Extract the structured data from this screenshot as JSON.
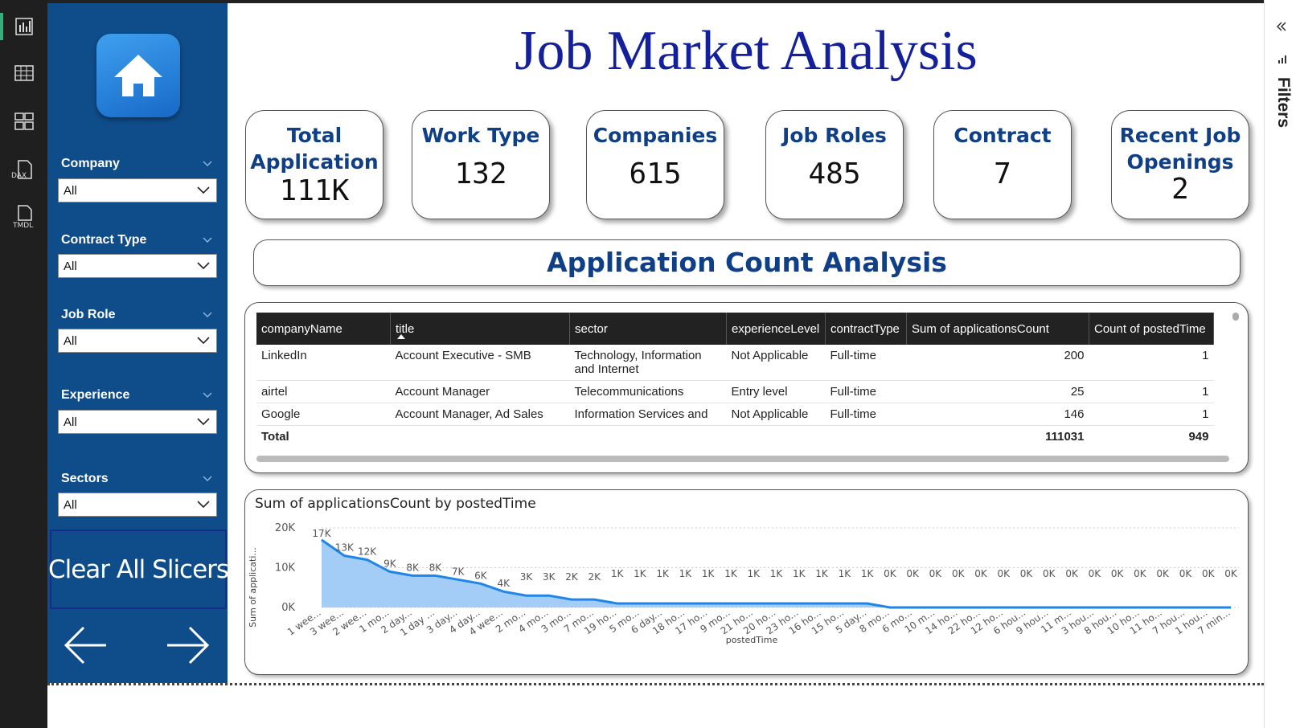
{
  "page_title": "Job Market Analysis",
  "slicers": [
    {
      "label": "Company",
      "value": "All"
    },
    {
      "label": "Contract Type",
      "value": "All"
    },
    {
      "label": "Job Role",
      "value": "All"
    },
    {
      "label": "Experience",
      "value": "All"
    },
    {
      "label": "Sectors",
      "value": "All"
    }
  ],
  "clear_button": "Clear All Slicers",
  "rail_icons": [
    "report-view-icon",
    "table-view-icon",
    "model-view-icon",
    "dax-query-icon",
    "tmdl-view-icon"
  ],
  "rail_labels": {
    "dax": "DAX",
    "tmdl": "TMDL"
  },
  "cards": [
    {
      "title": "Total Application",
      "value": "111K"
    },
    {
      "title": "Work Type",
      "value": "132"
    },
    {
      "title": "Companies",
      "value": "615"
    },
    {
      "title": "Job Roles",
      "value": "485"
    },
    {
      "title": "Contract",
      "value": "7"
    },
    {
      "title": "Recent Job Openings",
      "value": "2"
    }
  ],
  "section_banner": "Application Count Analysis",
  "table": {
    "columns": [
      "companyName",
      "title",
      "sector",
      "experienceLevel",
      "contractType",
      "Sum of applicationsCount",
      "Count of postedTime"
    ],
    "rows": [
      [
        "LinkedIn",
        "Account Executive - SMB",
        "Technology, Information and Internet",
        "Not Applicable",
        "Full-time",
        "200",
        "1"
      ],
      [
        "airtel",
        "Account Manager",
        "Telecommunications",
        "Entry level",
        "Full-time",
        "25",
        "1"
      ],
      [
        "Google",
        "Account Manager, Ad Sales",
        "Information Services and",
        "Not Applicable",
        "Full-time",
        "146",
        "1"
      ]
    ],
    "total": {
      "label": "Total",
      "sum": "111031",
      "count": "949"
    }
  },
  "filters_pane": {
    "label": "Filters"
  },
  "chart_data": {
    "type": "area",
    "title": "Sum of applicationsCount by postedTime",
    "xlabel": "postedTime",
    "ylabel": "Sum of applicati...",
    "ylim": [
      0,
      20000
    ],
    "yticks": [
      "0K",
      "10K",
      "20K"
    ],
    "color": "#99c8f6",
    "line_color": "#1f86e8",
    "categories": [
      "1 wee...",
      "3 wee...",
      "2 wee...",
      "1 mo...",
      "2 day...",
      "1 day ...",
      "3 day...",
      "4 day...",
      "4 wee...",
      "2 mo...",
      "4 mo...",
      "3 mo...",
      "7 mo...",
      "19 ho...",
      "5 mo...",
      "6 day...",
      "18 ho...",
      "17 ho...",
      "9 mo...",
      "21 ho...",
      "20 ho...",
      "23 ho...",
      "16 ho...",
      "15 ho...",
      "5 day...",
      "8 mo...",
      "6 mo...",
      "10 m...",
      "14 ho...",
      "22 ho...",
      "12 ho...",
      "6 hou...",
      "9 hou...",
      "11 m...",
      "3 hou...",
      "8 hou...",
      "10 ho...",
      "11 ho...",
      "7 hou...",
      "1 hou...",
      "7 min..."
    ],
    "values": [
      17000,
      13000,
      12000,
      9000,
      8000,
      8000,
      7000,
      6000,
      4000,
      3000,
      3000,
      2000,
      2000,
      1000,
      1000,
      1000,
      1000,
      1000,
      1000,
      1000,
      1000,
      1000,
      1000,
      1000,
      1000,
      0,
      0,
      0,
      0,
      0,
      0,
      0,
      0,
      0,
      0,
      0,
      0,
      0,
      0,
      0,
      0
    ],
    "data_labels": [
      "17K",
      "13K",
      "12K",
      "9K",
      "8K",
      "8K",
      "7K",
      "6K",
      "4K",
      "3K",
      "3K",
      "2K",
      "2K",
      "1K",
      "1K",
      "1K",
      "1K",
      "1K",
      "1K",
      "1K",
      "1K",
      "1K",
      "1K",
      "1K",
      "1K",
      "0K",
      "0K",
      "0K",
      "0K",
      "0K",
      "0K",
      "0K",
      "0K",
      "0K",
      "0K",
      "0K",
      "0K",
      "0K",
      "0K",
      "0K",
      "0K"
    ]
  }
}
